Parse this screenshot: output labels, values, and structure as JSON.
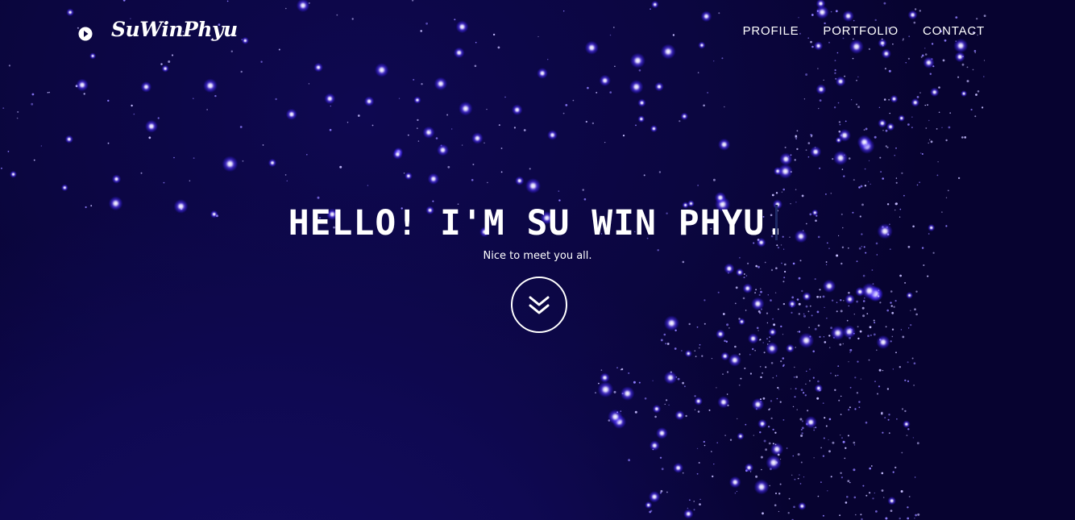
{
  "brand": {
    "name": "SuWinPhyu",
    "icon": "play-circle-icon"
  },
  "nav": {
    "items": [
      {
        "label": "PROFILE"
      },
      {
        "label": "PORTFOLIO"
      },
      {
        "label": "CONTACT"
      }
    ]
  },
  "hero": {
    "headline": "HELLO! I'M SU WIN PHYU.",
    "tagline": "Nice to meet you all.",
    "scroll_icon": "double-chevron-down-icon"
  },
  "colors": {
    "background": "#0b0640",
    "star_glow": "#4a2bff",
    "text": "#ffffff"
  }
}
